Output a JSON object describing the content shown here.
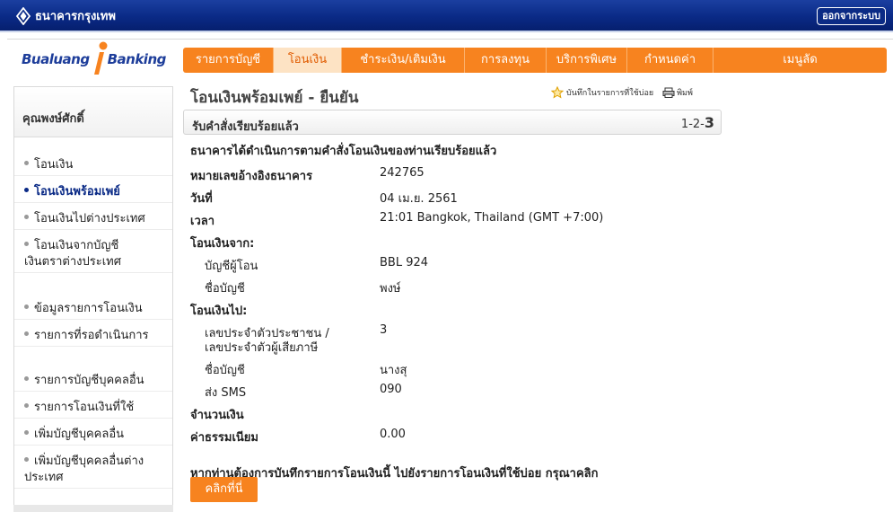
{
  "header": {
    "bank_name": "ธนาคารกรุงเทพ",
    "logout_label": "ออกจากระบบ"
  },
  "brand": {
    "part1": "Bualuang",
    "part2": "Banking"
  },
  "nav": {
    "items": [
      "รายการบัญชี",
      "โอนเงิน",
      "ชำระเงิน/เติมเงิน",
      "การลงทุน",
      "บริการพิเศษ",
      "กำหนดค่า",
      "เมนูลัด"
    ],
    "active": "โอนเงิน"
  },
  "sidebar": {
    "user_name": "คุณพงษ์ศักดิ์",
    "items": [
      "โอนเงิน",
      "โอนเงินพร้อมเพย์",
      "โอนเงินไปต่างประเทศ",
      "โอนเงินจากบัญชี",
      "เงินตราต่างประเทศ",
      "ข้อมูลรายการโอนเงิน",
      "รายการที่รอดำเนินการ",
      "รายการบัญชีบุคคลอื่น",
      "รายการโอนเงินที่ใช้",
      "เพิ่มบัญชีบุคคลอื่น",
      "เพิ่มบัญชีบุคคลอื่นต่าง",
      "ประเทศ"
    ]
  },
  "main": {
    "title": "โอนเงินพร้อมเพย์ - ยืนยัน",
    "save_favorite": "บันทึกในรายการที่ใช้บ่อย",
    "print": "พิมพ์",
    "step_label": "รับคำสั่งเรียบร้อยแล้ว",
    "step_prefix": "1-2-",
    "step_current": "3",
    "success_msg": "ธนาคารได้ดำเนินการตามคำสั่งโอนเงินของท่านเรียบร้อยแล้ว",
    "ref_label": "หมายเลขอ้างอิงธนาคาร",
    "ref_value": "242765",
    "date_label": "วันที่",
    "date_value": "04 เม.ย. 2561",
    "time_label": "เวลา",
    "time_value": "21:01 Bangkok, Thailand (GMT +7:00)",
    "from_label": "โอนเงินจาก:",
    "from_account_label": "บัญชีผู้โอน",
    "from_account_value": "BBL 924",
    "from_name_label": "ชื่อบัญชี",
    "from_name_value": "พงษ์",
    "to_label": "โอนเงินไป:",
    "to_id_label_1": "เลขประจำตัวประชาชน /",
    "to_id_label_2": "เลขประจำตัวผู้เสียภาษี",
    "to_id_value": "3",
    "to_name_label": "ชื่อบัญชี",
    "to_name_value": "นางสุ",
    "sms_label": "ส่ง SMS",
    "sms_value": "090",
    "amount_label": "จำนวนเงิน",
    "fee_label": "ค่าธรรมเนียม",
    "fee_value": "0.00",
    "save_prompt": "หากท่านต้องการบันทึกรายการโอนเงินนี้ ไปยังรายการโอนเงินที่ใช้บ่อย กรุณาคลิก",
    "click_button": "คลิกที่นี่"
  }
}
